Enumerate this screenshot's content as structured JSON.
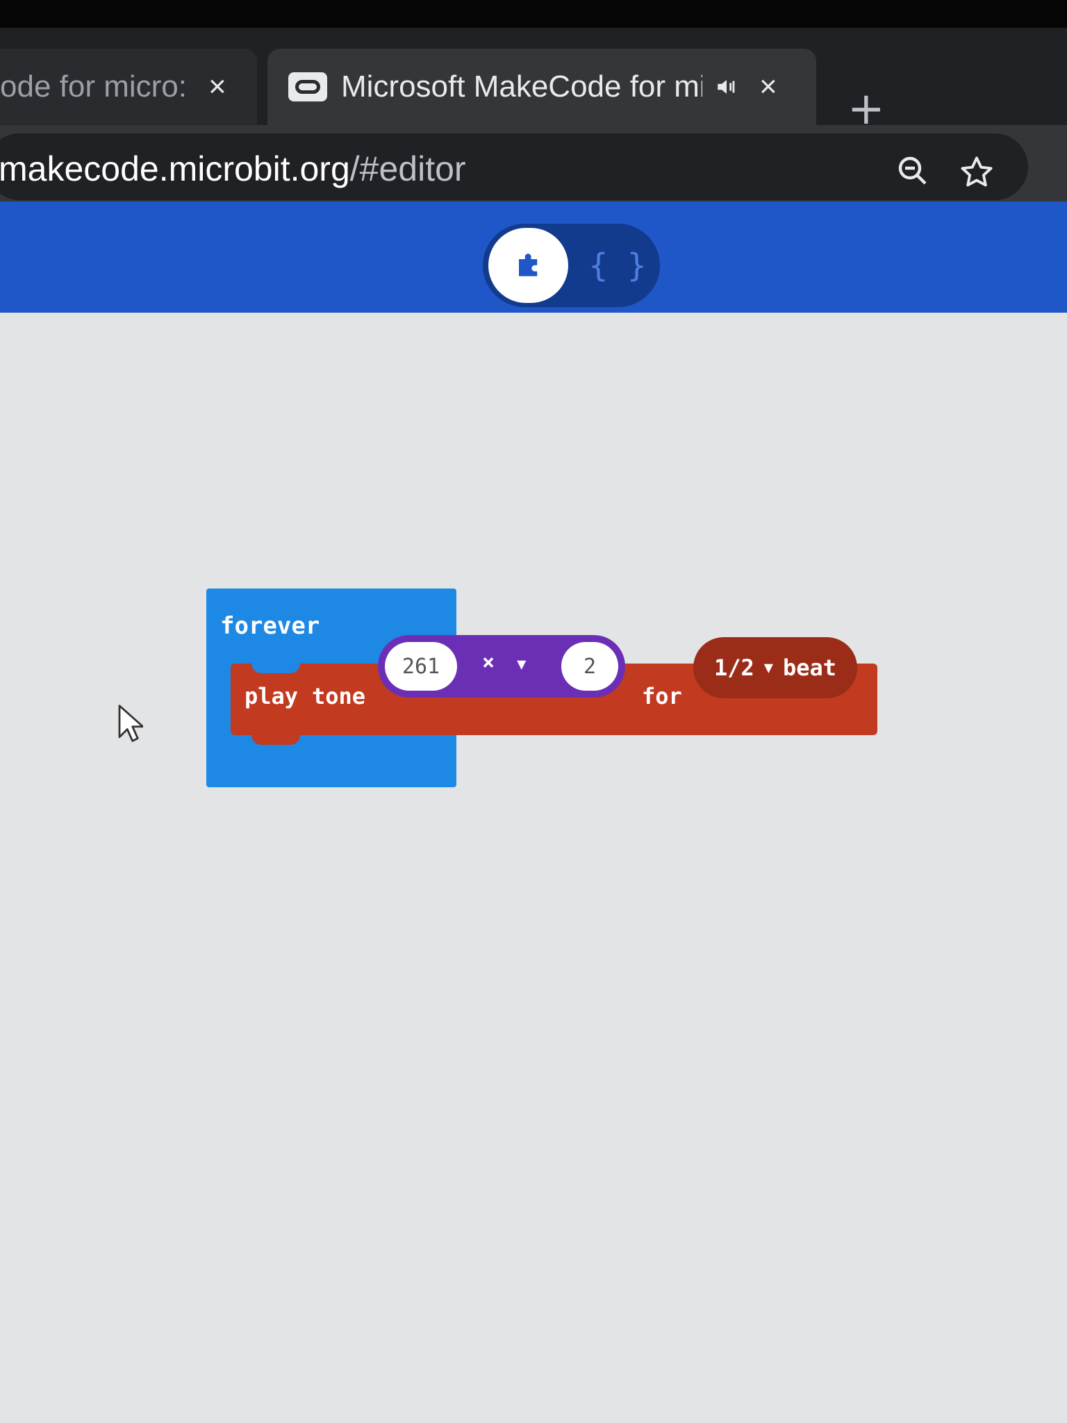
{
  "browser": {
    "tabs": [
      {
        "title": "ode for micro:bit",
        "close_icon": "×",
        "active": false
      },
      {
        "title": "Microsoft MakeCode for micro:bit",
        "close_icon": "×",
        "active": true,
        "audio_icon": "speaker-icon"
      }
    ],
    "new_tab_icon": "+",
    "address": {
      "host": "makecode.microbit.org",
      "path": "/#editor"
    }
  },
  "header": {
    "toggle": {
      "blocks_icon": "puzzle-icon",
      "javascript_label": "{ }",
      "active": "blocks"
    }
  },
  "workspace": {
    "forever_block": {
      "label": "forever"
    },
    "play_tone_block": {
      "play_label": "play",
      "tone_label": "tone",
      "frequency": "261",
      "operator": "×",
      "operand": "2",
      "for_label": "for",
      "duration": "1/2",
      "beat_label": "beat"
    }
  },
  "colors": {
    "header_blue": "#1f57c8",
    "forever_blue": "#1e88e5",
    "music_red": "#c23a20",
    "math_purple": "#6b2fb5",
    "workspace_bg": "#e2e4e6"
  }
}
